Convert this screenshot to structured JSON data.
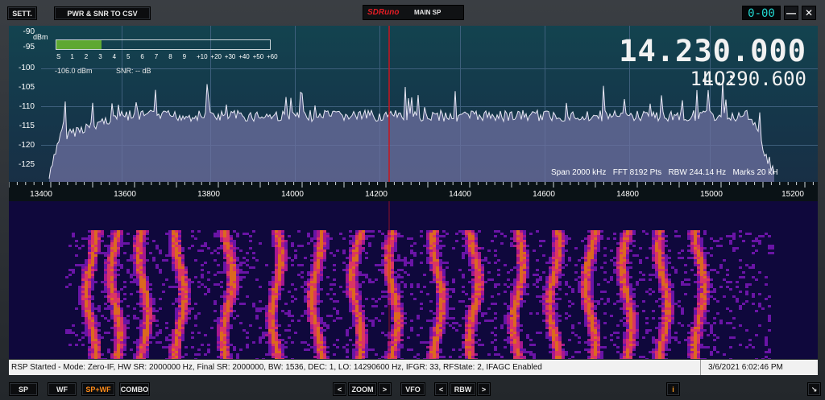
{
  "toolbar": {
    "sett_label": "SETT.",
    "csv_label": "PWR & SNR TO CSV",
    "app_logo": "SDRuno",
    "window_title": "MAIN SP",
    "clock": "0-00",
    "minimize": "—",
    "close": "✕"
  },
  "spectrum": {
    "frequency": "14.230.000",
    "lo_label": "LO:",
    "lo_value": "14.290.600",
    "unit": "dBm",
    "y_ticks": [
      "-90",
      "-95",
      "-100",
      "-105",
      "-110",
      "-115",
      "-120",
      "-125"
    ],
    "meter_scale": [
      "S",
      "1",
      "2",
      "3",
      "4",
      "5",
      "6",
      "7",
      "8",
      "9",
      "+10",
      "+20",
      "+30",
      "+40",
      "+50",
      "+60"
    ],
    "meter_level": 0.21,
    "power": "-106.0 dBm",
    "snr": "SNR: -- dB",
    "stats": "Span 2000 kHz   FFT 8192 Pts   RBW 244.14 Hz   Marks 20 kH",
    "x_ticks": [
      "13400",
      "13600",
      "13800",
      "14000",
      "14200",
      "14400",
      "14600",
      "14800",
      "15000",
      "15200"
    ],
    "colors": {
      "trace": "#e8e8f4",
      "marker": "#c8141e",
      "background": "#143f4d",
      "fill": "#6d70a0"
    }
  },
  "status": {
    "message": "RSP Started - Mode: Zero-IF, HW SR: 2000000 Hz, Final SR: 2000000, BW: 1536, DEC: 1, LO: 14290600 Hz, IFGR: 33, RFState: 2, IFAGC Enabled",
    "datetime": "3/6/2021 6:02:46 PM"
  },
  "bottom": {
    "sp": "SP",
    "wf": "WF",
    "spwf": "SP+WF",
    "combo": "COMBO",
    "zoom_left": "<",
    "zoom": "ZOOM",
    "zoom_right": ">",
    "vfo": "VFO",
    "rbw_left": "<",
    "rbw": "RBW",
    "rbw_right": ">",
    "info": "i",
    "resize": "↘"
  }
}
